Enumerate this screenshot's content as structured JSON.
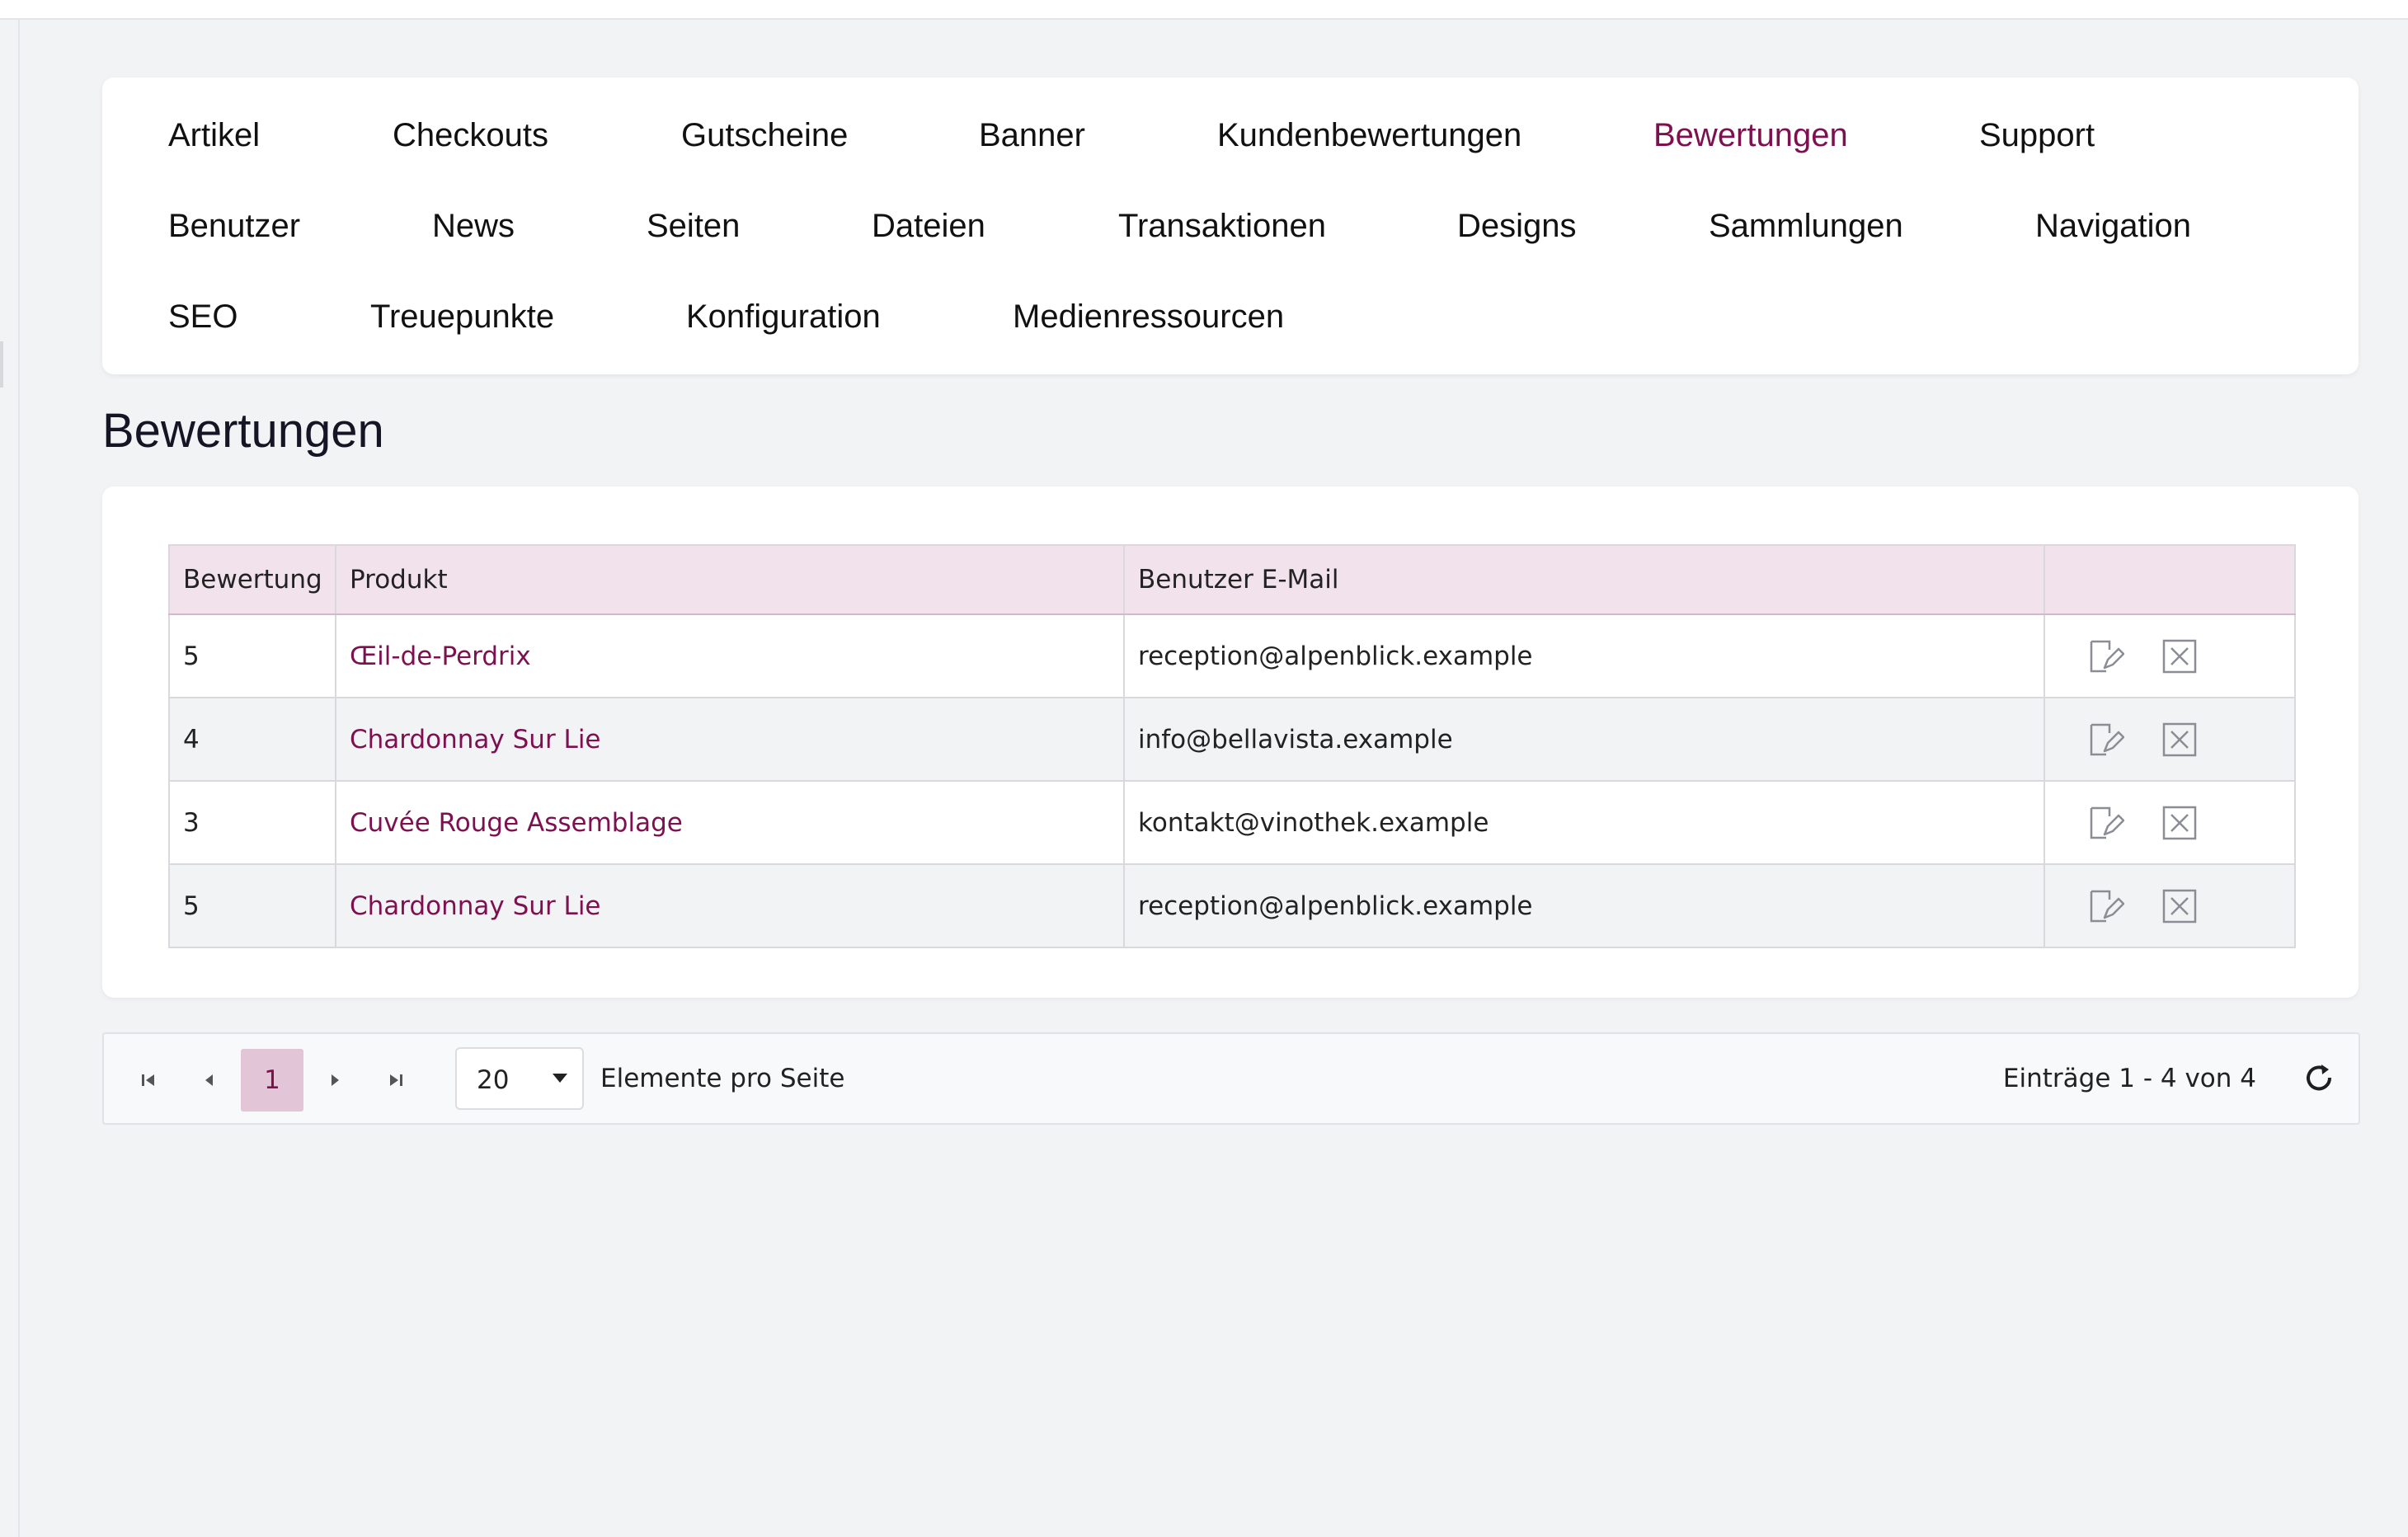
{
  "nav": {
    "items": [
      {
        "label": "Artikel",
        "active": false
      },
      {
        "label": "Checkouts",
        "active": false
      },
      {
        "label": "Gutscheine",
        "active": false
      },
      {
        "label": "Banner",
        "active": false
      },
      {
        "label": "Kundenbewertungen",
        "active": false
      },
      {
        "label": "Bewertungen",
        "active": true
      },
      {
        "label": "Support",
        "active": false
      },
      {
        "label": "Benutzer",
        "active": false
      },
      {
        "label": "News",
        "active": false
      },
      {
        "label": "Seiten",
        "active": false
      },
      {
        "label": "Dateien",
        "active": false
      },
      {
        "label": "Transaktionen",
        "active": false
      },
      {
        "label": "Designs",
        "active": false
      },
      {
        "label": "Sammlungen",
        "active": false
      },
      {
        "label": "Navigation",
        "active": false
      },
      {
        "label": "SEO",
        "active": false
      },
      {
        "label": "Treuepunkte",
        "active": false
      },
      {
        "label": "Konfiguration",
        "active": false
      },
      {
        "label": "Medienressourcen",
        "active": false
      }
    ],
    "active_color": "#7d1150"
  },
  "page": {
    "title": "Bewertungen"
  },
  "table": {
    "columns": [
      "Bewertung",
      "Produkt",
      "Benutzer E-Mail",
      ""
    ],
    "rows": [
      {
        "rating": "5",
        "product": "Œil-de-Perdrix",
        "email": "reception@alpenblick.example"
      },
      {
        "rating": "4",
        "product": "Chardonnay Sur Lie",
        "email": "info@bellavista.example"
      },
      {
        "rating": "3",
        "product": "Cuvée Rouge Assemblage",
        "email": "kontakt@vinothek.example"
      },
      {
        "rating": "5",
        "product": "Chardonnay Sur Lie",
        "email": "reception@alpenblick.example"
      }
    ],
    "row_actions": [
      "edit-icon",
      "delete-icon"
    ],
    "header_bg": "#f1e2ec",
    "link_color": "#7d1150"
  },
  "pager": {
    "current_page": "1",
    "page_size": "20",
    "page_size_label": "Elemente pro Seite",
    "info": "Einträge 1 - 4 von 4",
    "icons": [
      "first-page-icon",
      "prev-page-icon",
      "next-page-icon",
      "last-page-icon",
      "refresh-icon"
    ]
  }
}
